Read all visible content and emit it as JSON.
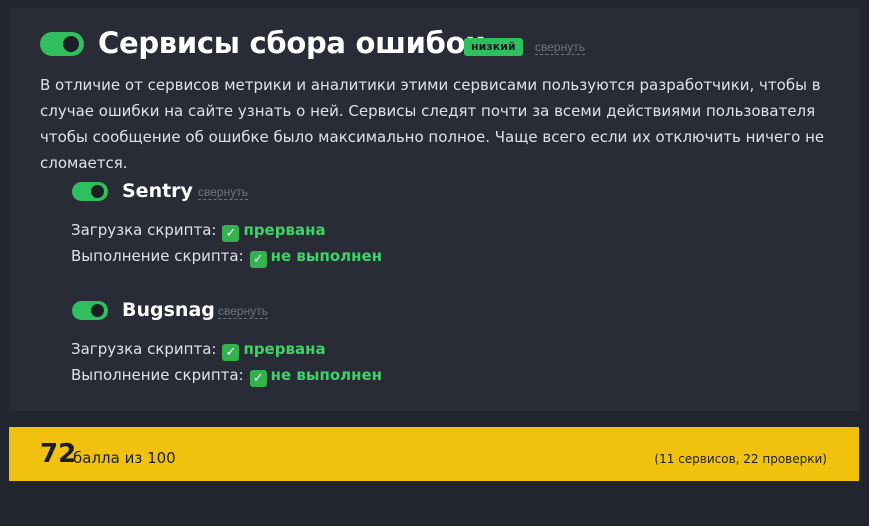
{
  "group": {
    "title": "Сервисы сбора ошибок",
    "badge": "низкий",
    "collapse_label": "свернуть",
    "enabled": true,
    "description": "В отличие от сервисов метрики и аналитики этими сервисами пользуются разработчики, чтобы в случае ошибки на сайте узнать о ней. Сервисы следят почти за всеми действиями пользователя чтобы сообщение об ошибке было максимально полное. Чаще всего если их отключить ничего не сломается."
  },
  "services": [
    {
      "name": "Sentry",
      "enabled": true,
      "collapse_label": "свернуть",
      "checks": [
        {
          "label": "Загрузка скрипта:",
          "icon": "check-mark-icon",
          "value": "прервана"
        },
        {
          "label": "Выполнение скрипта:",
          "icon": "check-mark-icon",
          "value": "не выполнен"
        }
      ]
    },
    {
      "name": "Bugsnag",
      "enabled": true,
      "collapse_label": "свернуть",
      "checks": [
        {
          "label": "Загрузка скрипта:",
          "icon": "check-mark-icon",
          "value": "прервана"
        },
        {
          "label": "Выполнение скрипта:",
          "icon": "check-mark-icon",
          "value": "не выполнен"
        }
      ]
    }
  ],
  "score": {
    "value": "72",
    "label": "балла из 100",
    "meta": "(11 сервисов, 22 проверки)"
  },
  "colors": {
    "toggle_on": "#2fbf5f",
    "status_ok": "#3ed366",
    "score_bar": "#f0c20e",
    "card_bg": "#292c37",
    "page_bg": "#22252e"
  }
}
